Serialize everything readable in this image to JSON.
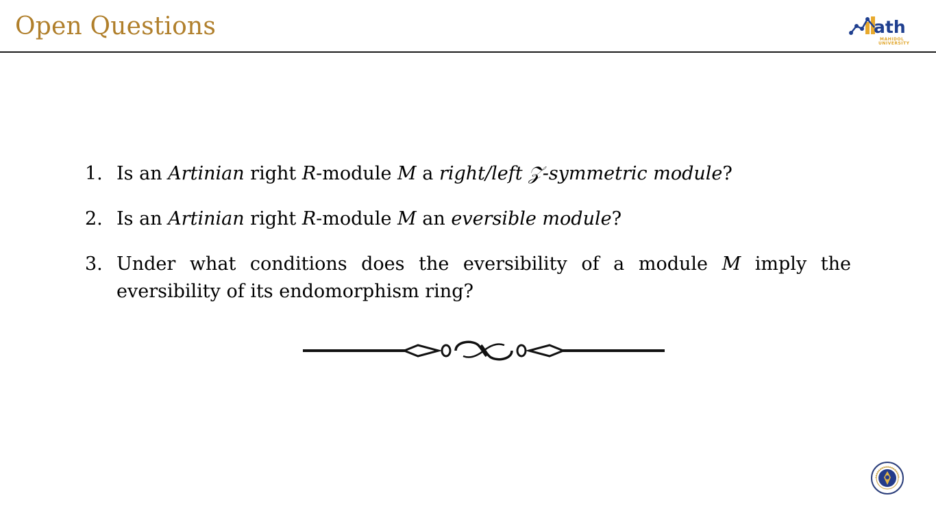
{
  "header": {
    "title": "Open Questions",
    "title_color": "#b07f2b",
    "logo": {
      "word": "ath",
      "line1": "MAHIDOL",
      "line2": "UNIVERSITY",
      "icon": "math-logo-icon"
    }
  },
  "questions": [
    {
      "number": "1.",
      "parts": [
        "Is an ",
        "Artinian",
        " right ",
        "R",
        "-module ",
        "M",
        " a ",
        "right/left 𝒵-symmetric module",
        "?"
      ]
    },
    {
      "number": "2.",
      "parts": [
        "Is an ",
        "Artinian",
        " right ",
        "R",
        "-module ",
        "M",
        " an ",
        "eversible module",
        "?"
      ]
    },
    {
      "number": "3.",
      "parts": [
        "Under what conditions does the eversibility of a module ",
        "M",
        " imply the eversibility of its endomorphism ring?"
      ]
    }
  ],
  "decorations": {
    "ornament": "flourish-divider-icon",
    "seal": "university-seal-icon"
  }
}
